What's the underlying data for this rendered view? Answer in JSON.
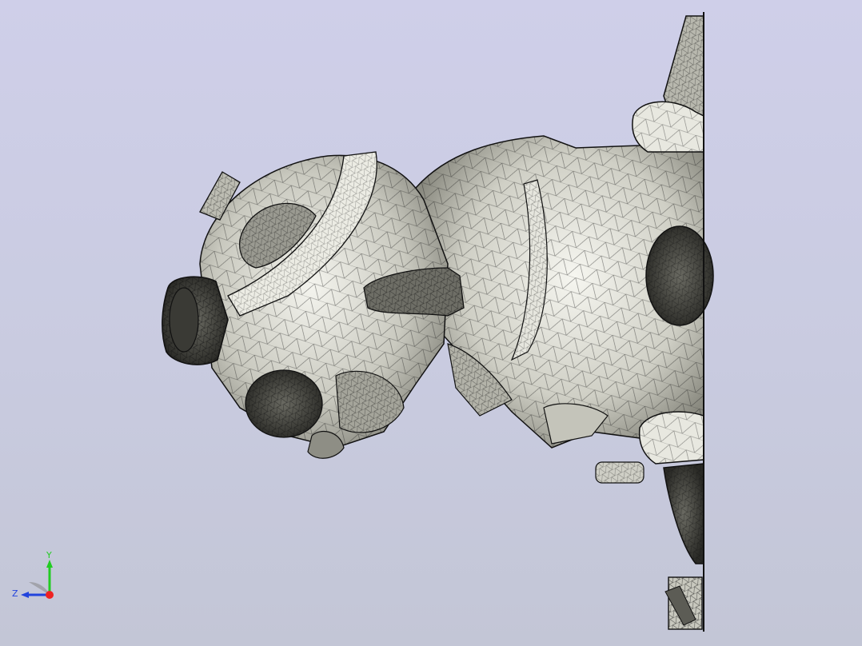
{
  "viewport": {
    "background_top": "#cfcfe9",
    "background_bottom": "#c3c6d6",
    "model_fill": "#d9d9d0",
    "mesh_color": "#1a1a1a"
  },
  "triad": {
    "y_label": "Y",
    "z_label": "Z",
    "y_color": "#22cc22",
    "z_color": "#2244dd",
    "x_color": "#ee2222"
  }
}
